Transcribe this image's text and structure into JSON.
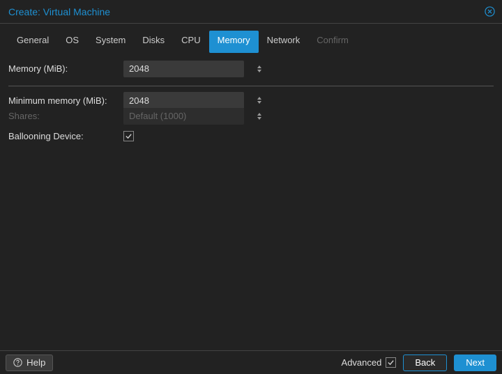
{
  "header": {
    "title": "Create: Virtual Machine"
  },
  "tabs": {
    "general": "General",
    "os": "OS",
    "system": "System",
    "disks": "Disks",
    "cpu": "CPU",
    "memory": "Memory",
    "network": "Network",
    "confirm": "Confirm"
  },
  "form": {
    "memory_label": "Memory (MiB):",
    "memory_value": "2048",
    "min_memory_label": "Minimum memory (MiB):",
    "min_memory_value": "2048",
    "shares_label": "Shares:",
    "shares_value": "Default (1000)",
    "ballooning_label": "Ballooning Device:"
  },
  "footer": {
    "help": "Help",
    "advanced": "Advanced",
    "back": "Back",
    "next": "Next"
  }
}
